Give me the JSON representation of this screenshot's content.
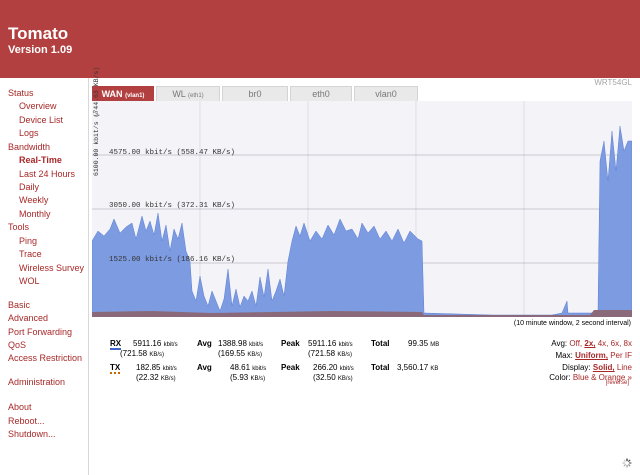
{
  "header": {
    "title": "Tomato",
    "version": "Version 1.09"
  },
  "model": "WRT54GL",
  "sidebar": {
    "status": "Status",
    "overview": "Overview",
    "device_list": "Device List",
    "logs": "Logs",
    "bandwidth": "Bandwidth",
    "real_time": "Real-Time",
    "last_24": "Last 24 Hours",
    "daily": "Daily",
    "weekly": "Weekly",
    "monthly": "Monthly",
    "tools": "Tools",
    "ping": "Ping",
    "trace": "Trace",
    "wireless_survey": "Wireless Survey",
    "wol": "WOL",
    "basic": "Basic",
    "advanced": "Advanced",
    "port_forwarding": "Port Forwarding",
    "qos": "QoS",
    "access_restriction": "Access Restriction",
    "administration": "Administration",
    "about": "About",
    "reboot": "Reboot...",
    "shutdown": "Shutdown..."
  },
  "tabs": [
    {
      "label": "WAN",
      "sub": "(vlan1)"
    },
    {
      "label": "WL",
      "sub": "(eth1)"
    },
    {
      "label": "br0",
      "sub": ""
    },
    {
      "label": "eth0",
      "sub": ""
    },
    {
      "label": "vlan0",
      "sub": ""
    }
  ],
  "graph": {
    "scale_label": "6100.00 kbit/s (744.63 KB/s)",
    "scale_arrow": ">",
    "grid_labels": [
      "4575.00 kbit/s (558.47 KB/s)",
      "3050.00 kbit/s (372.31 KB/s)",
      "1525.00 kbit/s (186.16 KB/s)"
    ],
    "rx_color": "#7d9be0",
    "tx_color": "#8a6a7a",
    "background": "#f4f4f8",
    "window_note": "(10 minute window, 2 second interval)"
  },
  "stats": {
    "rx": {
      "label": "RX",
      "current": "5911.16",
      "current_unit": "kbit/s",
      "current_kb": "(721.58",
      "current_kb_unit": "KB/s)",
      "avg_label": "Avg",
      "avg": "1388.98",
      "avg_unit": "kbit/s",
      "avg_kb": "(169.55",
      "avg_kb_unit": "KB/s)",
      "peak_label": "Peak",
      "peak": "5911.16",
      "peak_unit": "kbit/s",
      "peak_kb": "(721.58",
      "peak_kb_unit": "KB/s)",
      "total_label": "Total",
      "total": "99.35",
      "total_unit": "MB"
    },
    "tx": {
      "label": "TX",
      "current": "182.85",
      "current_unit": "kbit/s",
      "current_kb": "(22.32",
      "current_kb_unit": "KB/s)",
      "avg_label": "Avg",
      "avg": "48.61",
      "avg_unit": "kbit/s",
      "avg_kb": "(5.93",
      "avg_kb_unit": "KB/s)",
      "peak_label": "Peak",
      "peak": "266.20",
      "peak_unit": "kbit/s",
      "peak_kb": "(32.50",
      "peak_kb_unit": "KB/s)",
      "total_label": "Total",
      "total": "3,560.17",
      "total_unit": "KB"
    }
  },
  "options": {
    "avg_label": "Avg:",
    "avg_values": [
      "Off,",
      "2x,",
      "4x,",
      "6x,",
      "8x"
    ],
    "max_label": "Max:",
    "max_values": [
      "Uniform,",
      "Per IF"
    ],
    "display_label": "Display:",
    "display_values": [
      "Solid,",
      "Line"
    ],
    "color_label": "Color:",
    "color_value": "Blue & Orange »",
    "reverse": "[reverse]"
  }
}
